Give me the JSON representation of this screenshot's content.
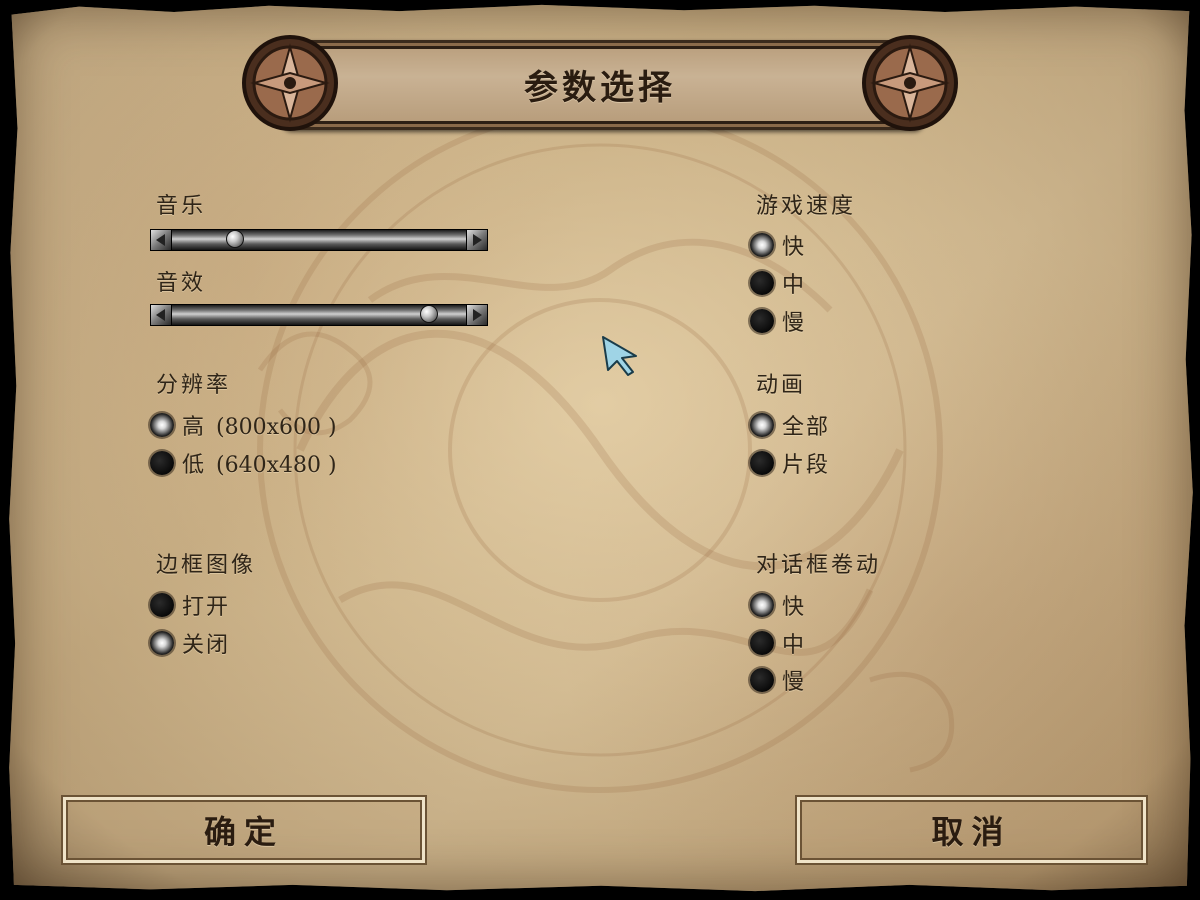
{
  "title": "参数选择",
  "music": {
    "label": "音乐",
    "value": 0.21
  },
  "sound_effects": {
    "label": "音效",
    "value": 0.88
  },
  "resolution": {
    "label": "分辨率",
    "options": [
      {
        "label": "高",
        "detail": "(800x600 )",
        "selected": true
      },
      {
        "label": "低",
        "detail": "(640x480 )",
        "selected": false
      }
    ]
  },
  "border_image": {
    "label": "边框图像",
    "options": [
      {
        "label": "打开",
        "selected": false
      },
      {
        "label": "关闭",
        "selected": true
      }
    ]
  },
  "game_speed": {
    "label": "游戏速度",
    "options": [
      {
        "label": "快",
        "selected": true
      },
      {
        "label": "中",
        "selected": false
      },
      {
        "label": "慢",
        "selected": false
      }
    ]
  },
  "animation": {
    "label": "动画",
    "options": [
      {
        "label": "全部",
        "selected": true
      },
      {
        "label": "片段",
        "selected": false
      }
    ]
  },
  "dialog_scroll": {
    "label": "对话框卷动",
    "options": [
      {
        "label": "快",
        "selected": true
      },
      {
        "label": "中",
        "selected": false
      },
      {
        "label": "慢",
        "selected": false
      }
    ]
  },
  "buttons": {
    "ok": "确定",
    "cancel": "取消"
  },
  "colors": {
    "parchment": "#d2bb92",
    "ink": "#2f2518",
    "accent": "#6b5335"
  },
  "icons": [
    "arrow-cursor-icon",
    "slider-left-arrow-icon",
    "slider-right-arrow-icon",
    "ornament-icon"
  ]
}
